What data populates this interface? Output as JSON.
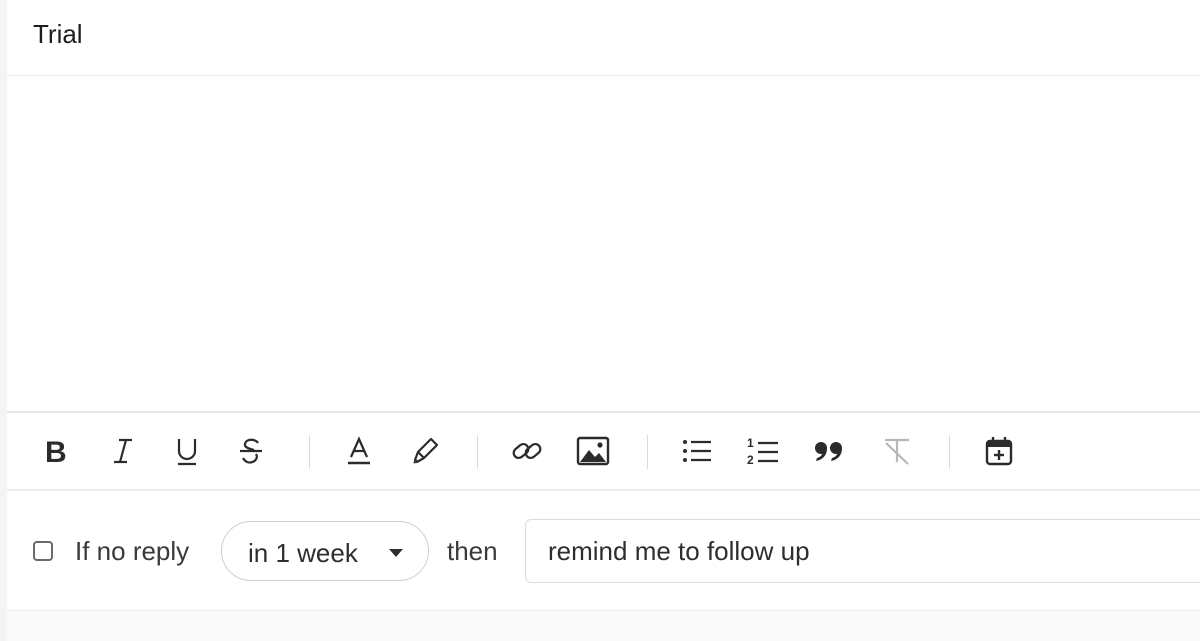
{
  "subject": {
    "value": "Trial"
  },
  "toolbar": {
    "buttons": [
      {
        "name": "bold",
        "icon": "bold-icon"
      },
      {
        "name": "italic",
        "icon": "italic-icon"
      },
      {
        "name": "underline",
        "icon": "underline-icon"
      },
      {
        "name": "strikethrough",
        "icon": "strikethrough-icon"
      },
      {
        "name": "text-color",
        "icon": "text-color-icon"
      },
      {
        "name": "highlight",
        "icon": "highlighter-icon"
      },
      {
        "name": "link",
        "icon": "link-icon"
      },
      {
        "name": "image",
        "icon": "image-icon"
      },
      {
        "name": "bulleted-list",
        "icon": "bulleted-list-icon"
      },
      {
        "name": "numbered-list",
        "icon": "numbered-list-icon"
      },
      {
        "name": "quote",
        "icon": "quote-icon"
      },
      {
        "name": "clear-formatting",
        "icon": "clear-formatting-icon"
      },
      {
        "name": "schedule",
        "icon": "calendar-add-icon"
      }
    ]
  },
  "followup": {
    "checkbox_checked": false,
    "if_label": "If no reply",
    "timeframe": "in 1 week",
    "then_label": "then",
    "action": "remind me to follow up"
  },
  "colors": {
    "border": "#dcdcdc",
    "text": "#2e2e2e"
  }
}
